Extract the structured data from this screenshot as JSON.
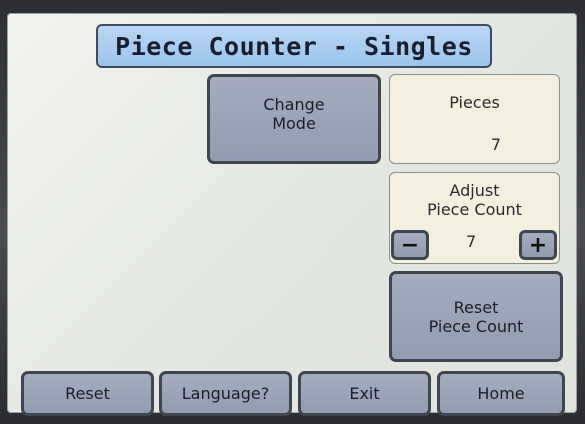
{
  "title": "Piece Counter - Singles",
  "change_mode_label": "Change\nMode",
  "pieces": {
    "label": "Pieces",
    "value": "7"
  },
  "adjust": {
    "label": "Adjust\nPiece Count",
    "value": "7",
    "minus": "−",
    "plus": "+"
  },
  "reset_count_label": "Reset\nPiece Count",
  "bottom_bar": {
    "reset": "Reset",
    "language": "Language?",
    "exit": "Exit",
    "home": "Home"
  },
  "colors": {
    "button_fill": "#9aa3b7",
    "panel_fill": "#f3f0df",
    "title_fill": "#a8cdee"
  }
}
